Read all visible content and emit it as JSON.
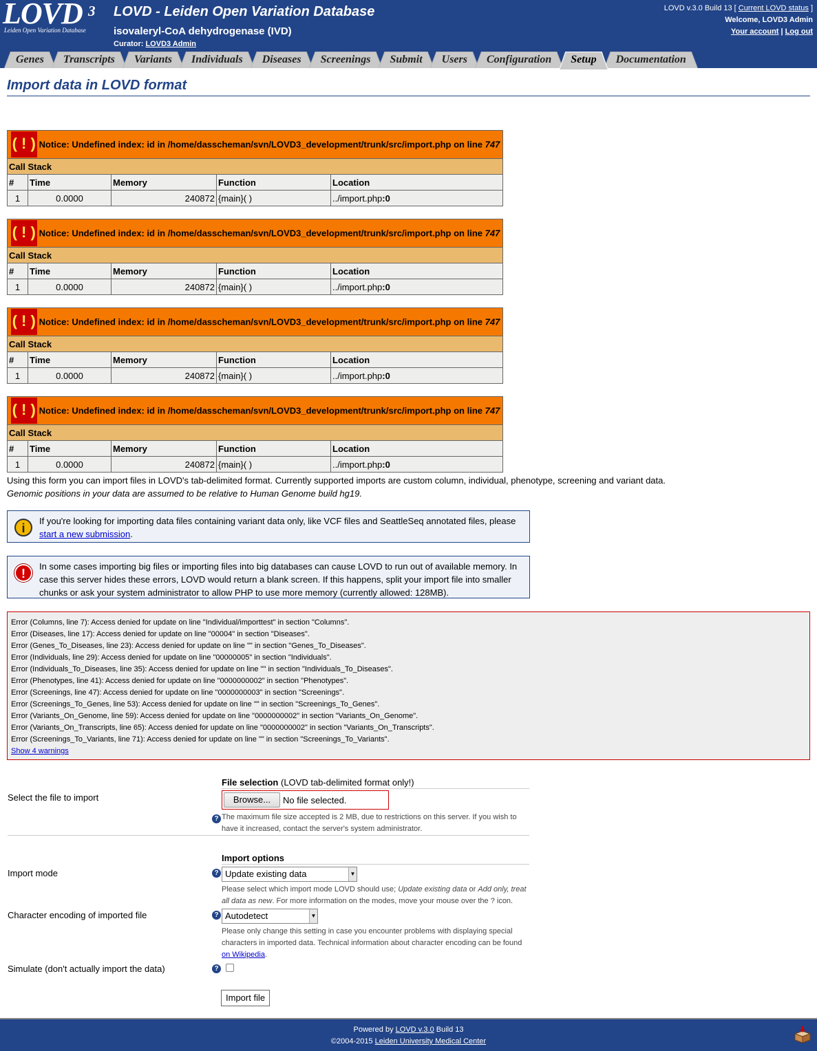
{
  "header": {
    "logo_text": "LOVD",
    "logo_sup": "3",
    "logo_tagline": "Leiden Open Variation Database",
    "site_title": "LOVD - Leiden Open Variation Database",
    "gene_title": "isovaleryl-CoA dehydrogenase (IVD)",
    "curator_label": "Curator:",
    "curator_name": "LOVD3 Admin",
    "version_prefix": "LOVD v.3.0 Build 13 [",
    "status_link": "Current LOVD status",
    "version_suffix": "]",
    "welcome": "Welcome, LOVD3 Admin",
    "account_link": "Your account",
    "separator": "|",
    "logout_link": "Log out"
  },
  "tabs": [
    {
      "label": "Genes"
    },
    {
      "label": "Transcripts"
    },
    {
      "label": "Variants"
    },
    {
      "label": "Individuals"
    },
    {
      "label": "Diseases"
    },
    {
      "label": "Screenings"
    },
    {
      "label": "Submit"
    },
    {
      "label": "Users"
    },
    {
      "label": "Configuration"
    },
    {
      "label": "Setup",
      "active": true
    },
    {
      "label": "Documentation"
    }
  ],
  "page_title": "Import data in LOVD format",
  "notice": {
    "bang": "( ! )",
    "message": "Notice: Undefined index: id in /home/dasscheman/svn/LOVD3_development/trunk/src/import.php on line",
    "line": "747",
    "call_stack": "Call Stack",
    "columns": [
      "#",
      "Time",
      "Memory",
      "Function",
      "Location"
    ],
    "row": [
      "1",
      "0.0000",
      "240872",
      "{main}( )",
      "../import.php",
      ":0"
    ]
  },
  "intro": {
    "line1": "Using this form you can import files in LOVD's tab-delimited format. Currently supported imports are custom column, individual, phenotype, screening and variant data.",
    "line2": "Genomic positions in your data are assumed to be relative to Human Genome build hg19."
  },
  "info_vcf": {
    "icon": "i",
    "text": "If you're looking for importing data files containing variant data only, like VCF files and SeattleSeq annotated files, please",
    "link": "start a new submission",
    "end": "."
  },
  "info_memory": {
    "icon": "!",
    "text": "In some cases importing big files or importing files into big databases can cause LOVD to run out of available memory. In case this server hides these errors, LOVD would return a blank screen. If this happens, split your import file into smaller chunks or ask your system administrator to allow PHP to use more memory (currently allowed: 128MB)."
  },
  "errors": [
    "Error (Columns, line 7): Access denied for update on line \"Individual/importtest\" in section \"Columns\".",
    "Error (Diseases, line 17): Access denied for update on line \"00004\" in section \"Diseases\".",
    "Error (Genes_To_Diseases, line 23): Access denied for update on line \"\" in section \"Genes_To_Diseases\".",
    "Error (Individuals, line 29): Access denied for update on line \"00000005\" in section \"Individuals\".",
    "Error (Individuals_To_Diseases, line 35): Access denied for update on line \"\" in section \"Individuals_To_Diseases\".",
    "Error (Phenotypes, line 41): Access denied for update on line \"0000000002\" in section \"Phenotypes\".",
    "Error (Screenings, line 47): Access denied for update on line \"0000000003\" in section \"Screenings\".",
    "Error (Screenings_To_Genes, line 53): Access denied for update on line \"\" in section \"Screenings_To_Genes\".",
    "Error (Variants_On_Genome, line 59): Access denied for update on line \"0000000002\" in section \"Variants_On_Genome\".",
    "Error (Variants_On_Transcripts, line 65): Access denied for update on line \"0000000002\" in section \"Variants_On_Transcripts\".",
    "Error (Screenings_To_Variants, line 71): Access denied for update on line \"\" in section \"Screenings_To_Variants\"."
  ],
  "show_warnings": "Show 4 warnings",
  "form": {
    "file_section_title": "File selection",
    "file_section_note": "(LOVD tab-delimited format only!)",
    "file_label": "Select the file to import",
    "browse_label": "Browse...",
    "no_file": "No file selected.",
    "file_note": "The maximum file size accepted is 2 MB, due to restrictions on this server. If you wish to have it increased, contact the server's system administrator.",
    "options_title": "Import options",
    "mode_label": "Import mode",
    "mode_value": "Update existing data",
    "mode_note_a": "Please select which import mode LOVD should use;",
    "mode_note_b": "Update existing data",
    "mode_note_c": "or",
    "mode_note_d": "Add only, treat all data as new",
    "mode_note_e": ". For more information on the modes, move your mouse over the ? icon.",
    "charset_label": "Character encoding of imported file",
    "charset_value": "Autodetect",
    "charset_note": "Please only change this setting in case you encounter problems with displaying special characters in imported data. Technical information about character encoding can be found",
    "charset_link": "on Wikipedia",
    "charset_end": ".",
    "simulate_label": "Simulate (don't actually import the data)",
    "help_glyph": "?",
    "submit_label": "Import file"
  },
  "footer": {
    "powered_by": "Powered by",
    "lovd_link": "LOVD v.3.0",
    "build": "Build 13",
    "copyright": "©2004-2015",
    "lumc_link": "Leiden University Medical Center"
  }
}
